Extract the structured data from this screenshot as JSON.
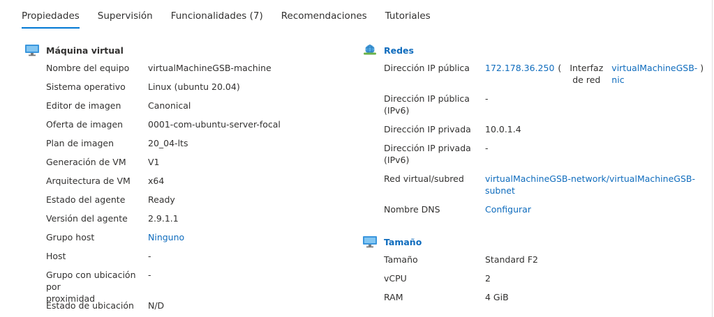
{
  "tabs": [
    {
      "label": "Propiedades",
      "active": true
    },
    {
      "label": "Supervisión"
    },
    {
      "label": "Funcionalidades (7)"
    },
    {
      "label": "Recomendaciones"
    },
    {
      "label": "Tutoriales"
    }
  ],
  "vm": {
    "title": "Máquina virtual",
    "icon": "monitor-icon",
    "rows": [
      {
        "label": "Nombre del equipo",
        "value": "virtualMachineGSB-machine"
      },
      {
        "label": "Sistema operativo",
        "value": "Linux (ubuntu 20.04)"
      },
      {
        "label": "Editor de imagen",
        "value": "Canonical"
      },
      {
        "label": "Oferta de imagen",
        "value": "0001-com-ubuntu-server-focal"
      },
      {
        "label": "Plan de imagen",
        "value": "20_04-lts"
      },
      {
        "label": "Generación de VM",
        "value": "V1"
      },
      {
        "label": "Arquitectura de VM",
        "value": "x64"
      },
      {
        "label": "Estado del agente",
        "value": "Ready"
      },
      {
        "label": "Versión del agente",
        "value": "2.9.1.1"
      },
      {
        "label": "Grupo host",
        "value": "Ninguno"
      },
      {
        "label": "Host",
        "value": "-"
      },
      {
        "label_line1": "Grupo con ubicación por",
        "label_line2": "proximidad",
        "value": "-"
      },
      {
        "label": "Estado de ubicación",
        "value": "N/D"
      }
    ]
  },
  "net": {
    "title": "Redes",
    "icon": "network-globe-icon",
    "public_ip": {
      "label": "Dirección IP pública",
      "ip": "172.178.36.250",
      "paren_open": "(",
      "iface_line1": "Interfaz",
      "iface_line2": "de red",
      "nic_line1": "virtualMachineGSB-",
      "nic_line2": "nic",
      "paren_close": ")"
    },
    "public_ipv6": {
      "label_line1": "Dirección IP pública",
      "label_line2": "(IPv6)",
      "value": "-"
    },
    "private_ip": {
      "label": "Dirección IP privada",
      "value": "10.0.1.4"
    },
    "private_ipv6": {
      "label_line1": "Dirección IP privada",
      "label_line2": "(IPv6)",
      "value": "-"
    },
    "vnet": {
      "label": "Red virtual/subred",
      "value_line1": "virtualMachineGSB-network/virtualMachineGSB-",
      "value_line2": "subnet"
    },
    "dns": {
      "label": "Nombre DNS",
      "value": "Configurar"
    }
  },
  "size": {
    "title": "Tamaño",
    "icon": "monitor-icon",
    "rows": [
      {
        "label": "Tamaño",
        "value": "Standard F2"
      },
      {
        "label": "vCPU",
        "value": "2"
      },
      {
        "label": "RAM",
        "value": "4 GiB"
      }
    ]
  },
  "colors": {
    "accent": "#0078d4",
    "link": "#0f6cbd",
    "text": "#323130"
  }
}
